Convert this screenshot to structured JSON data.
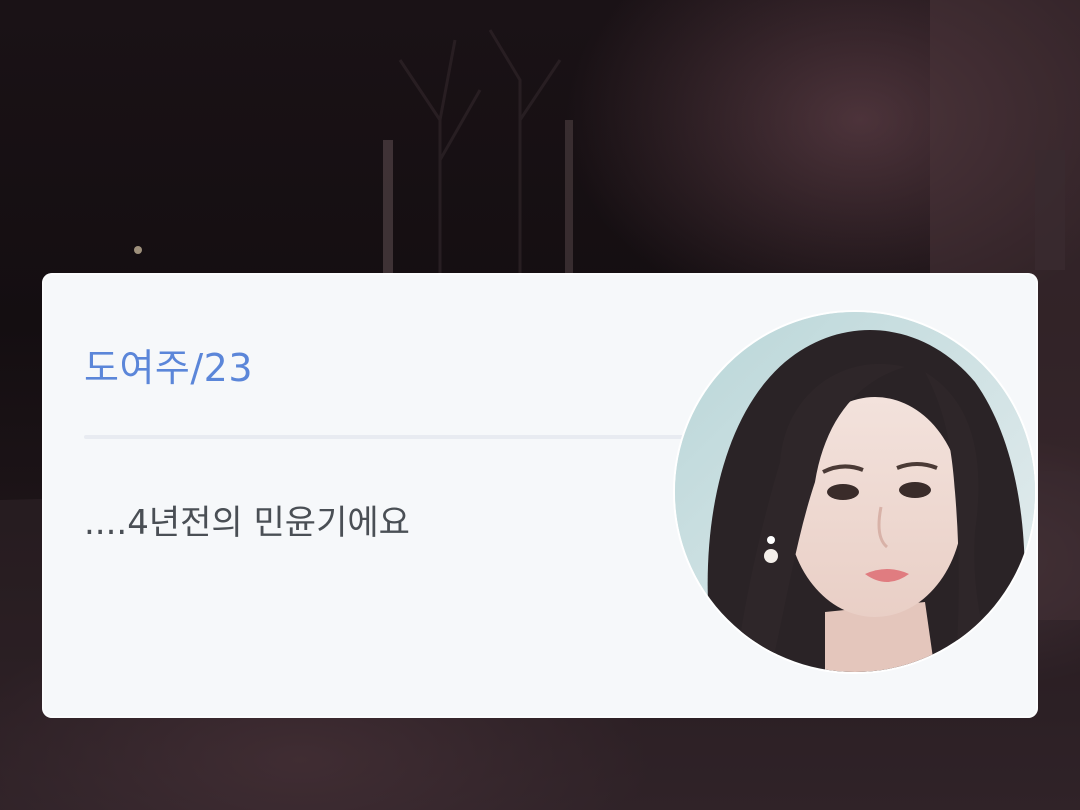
{
  "profile_card": {
    "name_age": "도여주/23",
    "message": "....4년전의 민윤기에요"
  },
  "avatar": {
    "icon": "portrait-photo"
  },
  "colors": {
    "accent": "#5b86d9",
    "card_background": "#f6f8fa",
    "message_text": "#4a4f55"
  }
}
